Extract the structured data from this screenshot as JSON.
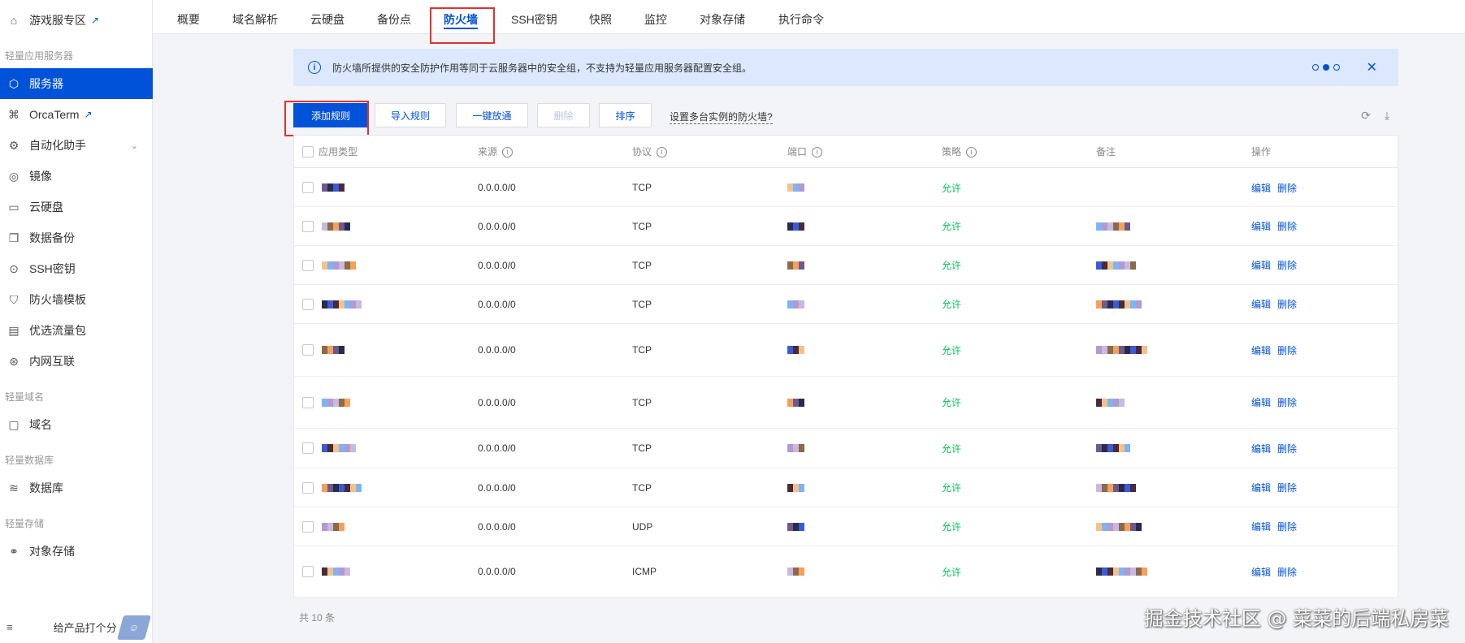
{
  "sidebar": {
    "top_item": {
      "label": "游戏服专区",
      "icon": "gamepad-icon"
    },
    "groups": [
      {
        "label": "轻量应用服务器"
      },
      {
        "label": "轻量域名"
      },
      {
        "label": "轻量数据库"
      },
      {
        "label": "轻量存储"
      }
    ],
    "items": [
      {
        "label": "服务器",
        "icon": "cube-icon",
        "active": true
      },
      {
        "label": "OrcaTerm",
        "icon": "terminal-icon"
      },
      {
        "label": "自动化助手",
        "icon": "robot-icon"
      },
      {
        "label": "镜像",
        "icon": "disc-icon"
      },
      {
        "label": "云硬盘",
        "icon": "disk-icon"
      },
      {
        "label": "数据备份",
        "icon": "backup-icon"
      },
      {
        "label": "SSH密钥",
        "icon": "key-icon"
      },
      {
        "label": "防火墙模板",
        "icon": "shield-icon"
      },
      {
        "label": "优选流量包",
        "icon": "traffic-icon"
      },
      {
        "label": "内网互联",
        "icon": "network-icon"
      },
      {
        "label": "域名",
        "icon": "domain-icon"
      },
      {
        "label": "数据库",
        "icon": "database-icon"
      },
      {
        "label": "对象存储",
        "icon": "storage-icon"
      }
    ],
    "rate_label": "给产品打个分"
  },
  "tabs": [
    "概要",
    "域名解析",
    "云硬盘",
    "备份点",
    "防火墙",
    "SSH密钥",
    "快照",
    "监控",
    "对象存储",
    "执行命令"
  ],
  "active_tab": "防火墙",
  "notice": {
    "text": "防火墙所提供的安全防护作用等同于云服务器中的安全组，不支持为轻量应用服务器配置安全组。"
  },
  "toolbar": {
    "add": "添加规则",
    "import": "导入规则",
    "allow_all": "一键放通",
    "delete": "删除",
    "sort": "排序",
    "help": "设置多台实例的防火墙?"
  },
  "table": {
    "headers": {
      "app": "应用类型",
      "source": "来源",
      "protocol": "协议",
      "port": "端口",
      "policy": "策略",
      "remark": "备注",
      "actions": "操作"
    },
    "rows": [
      {
        "source": "0.0.0.0/0",
        "protocol": "TCP",
        "policy": "允许",
        "edit": "编辑",
        "del": "删除"
      },
      {
        "source": "0.0.0.0/0",
        "protocol": "TCP",
        "policy": "允许",
        "edit": "编辑",
        "del": "删除"
      },
      {
        "source": "0.0.0.0/0",
        "protocol": "TCP",
        "policy": "允许",
        "edit": "编辑",
        "del": "删除"
      },
      {
        "source": "0.0.0.0/0",
        "protocol": "TCP",
        "policy": "允许",
        "edit": "编辑",
        "del": "删除"
      },
      {
        "source": "0.0.0.0/0",
        "protocol": "TCP",
        "policy": "允许",
        "edit": "编辑",
        "del": "删除"
      },
      {
        "source": "0.0.0.0/0",
        "protocol": "TCP",
        "policy": "允许",
        "edit": "编辑",
        "del": "删除"
      },
      {
        "source": "0.0.0.0/0",
        "protocol": "TCP",
        "policy": "允许",
        "edit": "编辑",
        "del": "删除"
      },
      {
        "source": "0.0.0.0/0",
        "protocol": "TCP",
        "policy": "允许",
        "edit": "编辑",
        "del": "删除"
      },
      {
        "source": "0.0.0.0/0",
        "protocol": "UDP",
        "policy": "允许",
        "edit": "编辑",
        "del": "删除"
      },
      {
        "source": "0.0.0.0/0",
        "protocol": "ICMP",
        "policy": "允许",
        "edit": "编辑",
        "del": "删除"
      }
    ],
    "total": "共 10 条"
  },
  "watermark": "掘金技术社区 @ 菜菜的后端私房菜",
  "colors": {
    "primary": "#0052d9",
    "allow": "#0abf5b",
    "notice_bg": "#dbe8fd",
    "highlight": "#e03131"
  }
}
